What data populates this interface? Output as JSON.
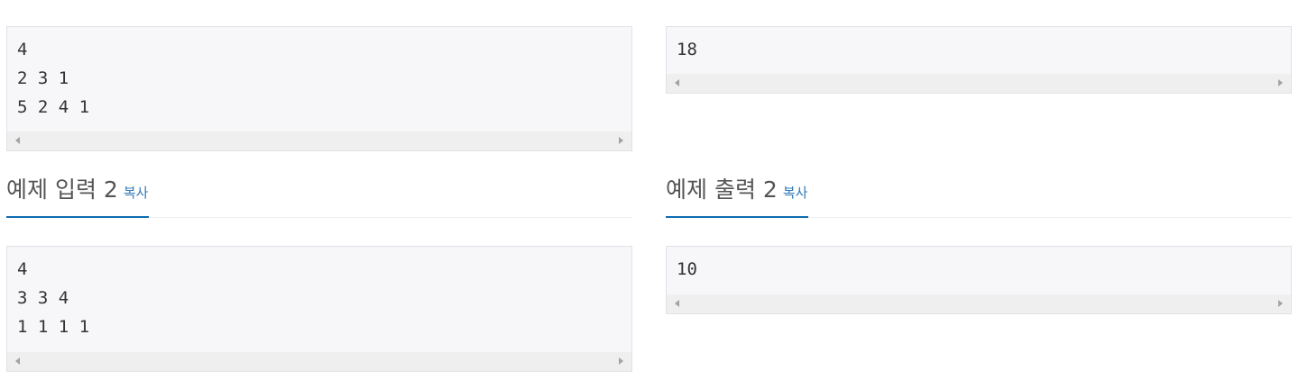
{
  "samples": {
    "input1": {
      "text": "4\n2 3 1\n5 2 4 1"
    },
    "output1": {
      "text": "18"
    },
    "input2": {
      "title": "예제 입력 2",
      "copy_label": "복사",
      "text": "4\n3 3 4\n1 1 1 1"
    },
    "output2": {
      "title": "예제 출력 2",
      "copy_label": "복사",
      "text": "10"
    }
  },
  "colors": {
    "accent_underline": "#0f6cb0",
    "copy_link": "#337ab7",
    "sample_background": "#f7f7f9"
  },
  "icons": {
    "scroll_left": "scroll-left-arrow-icon",
    "scroll_right": "scroll-right-arrow-icon"
  }
}
